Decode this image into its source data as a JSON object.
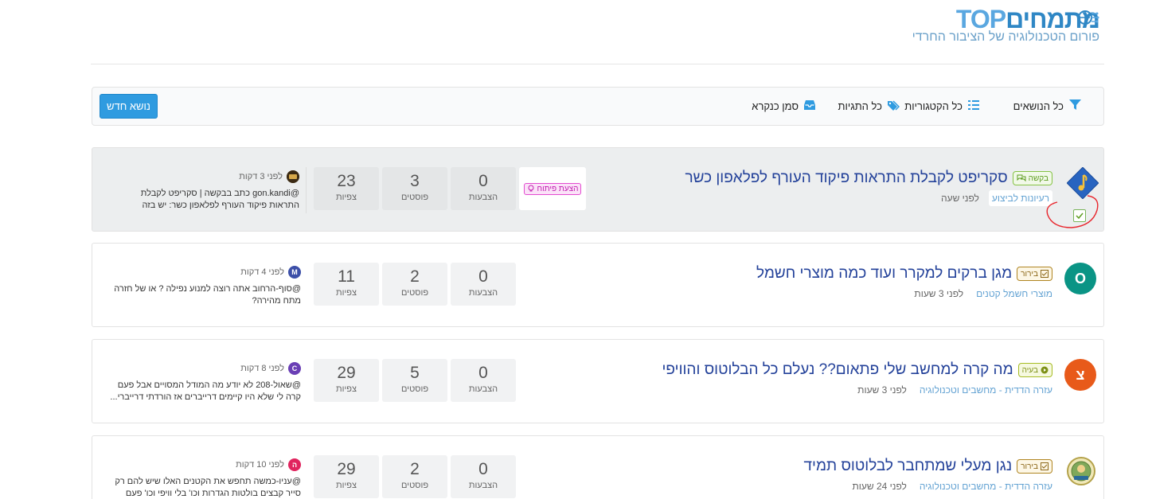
{
  "header": {
    "logo_hebrew": "מתמחים",
    "logo_latin": "TOP",
    "logo_subtitle": "פורום הטכנולוגיה של הציבור החרדי"
  },
  "toolbar": {
    "new_topic": "נושא חדש",
    "all_topics": "כל הנושאים",
    "all_categories": "כל הקטגוריות",
    "all_tags": "כל התגיות",
    "mark_read": "סמן כנקרא"
  },
  "stat_labels": {
    "votes": "הצבעות",
    "posts": "פוסטים",
    "views": "צפיות"
  },
  "topics": [
    {
      "title": "סקריפט לקבלת התראות פיקוד העורף לפלאפון כשר",
      "tag": "בקשה",
      "category": "רעיונות לביצוע",
      "time": "לפני שעה",
      "dev_tag": "הצעת פיתוח",
      "votes": "0",
      "posts": "3",
      "views": "23",
      "last_time": "לפני 3 דקות",
      "last_text": "@gon.kandi כתב בבקשה | סקריפט לקבלת התראות פיקוד העורף לפלאפון כשר: יש בזה בעיה..."
    },
    {
      "title": "מגן ברקים למקרר ועוד כמה מוצרי חשמל",
      "tag": "בירור",
      "category": "מוצרי חשמל קטנים",
      "time": "לפני 3 שעות",
      "avatar_letter": "O",
      "avatar_color": "#0a9485",
      "votes": "0",
      "posts": "2",
      "views": "11",
      "last_avatar": "M",
      "last_avatar_color": "#3c4fa8",
      "last_time": "לפני 4 דקות",
      "last_text": "@סוף-הרחוב אתה רוצה למנוע נפילה ? או של חזרה מתח מהירה?"
    },
    {
      "title": "מה קרה למחשב שלי פתאום?? נעלם כל הבלוטוס והוויפי",
      "tag": "בעיה",
      "category": "עזרה הדדית - מחשבים וטכנולוגיה",
      "time": "לפני 3 שעות",
      "avatar_letter": "צ",
      "avatar_color": "#e85a1a",
      "votes": "0",
      "posts": "5",
      "views": "29",
      "last_avatar": "C",
      "last_avatar_color": "#6a3fb5",
      "last_time": "לפני 8 דקות",
      "last_text": "@שאול-208 לא יודע מה המודל המסויים אבל פעם קרה לי שלא היו קיימים דרייברים אז הורדתי דרייברי..."
    },
    {
      "title": "נגן מעלי שמתחבר לבלוטוס תמיד",
      "tag": "בירור",
      "category": "עזרה הדדית - מחשבים וטכנולוגיה",
      "time": "לפני 24 שעות",
      "votes": "0",
      "posts": "2",
      "views": "29",
      "last_avatar": "ה",
      "last_avatar_color": "#e0245e",
      "last_time": "לפני 10 דקות",
      "last_text": "@עניו-כמשה תחפש את הקטנים האלו שיש להם רק סייר קבצים בולטות הגדרות וכו' בלי וויפי וכו' פעם ה'..."
    }
  ],
  "colors": {
    "accent": "#2f9be0",
    "title": "#24429a",
    "category": "#64a3d3",
    "annotation": "#e8262d"
  }
}
